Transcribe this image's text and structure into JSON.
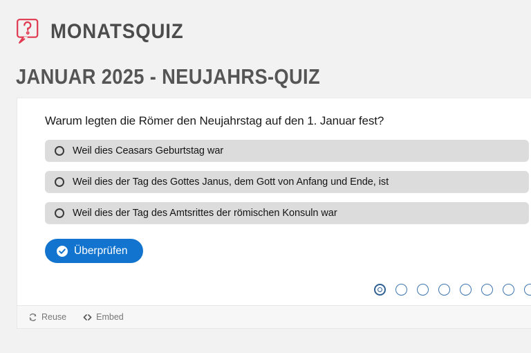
{
  "brand": {
    "icon": "question-speech-bubble-icon",
    "name": "MONATSQUIZ",
    "icon_color": "#e0384f"
  },
  "quiz": {
    "title": "JANUAR 2025 - NEUJAHRS-QUIZ",
    "question": "Warum legten die Römer den Neujahrstag auf den 1. Januar fest?",
    "options": [
      {
        "label": "Weil dies Ceasars Geburtstag war",
        "selected": false
      },
      {
        "label": "Weil dies der Tag des Gottes Janus, dem Gott von Anfang und Ende, ist",
        "selected": false
      },
      {
        "label": "Weil dies der Tag des Amtsrittes der römischen Konsuln war",
        "selected": false
      }
    ],
    "check_button": {
      "label": "Überprüfen",
      "icon": "check-circle-icon",
      "color": "#1274ce"
    }
  },
  "pagination": {
    "total": 8,
    "current": 1,
    "color": "#3b74ae"
  },
  "footer": {
    "reuse_label": "Reuse",
    "reuse_icon": "sync-arrows-icon",
    "embed_label": "Embed",
    "embed_icon": "code-brackets-icon"
  }
}
